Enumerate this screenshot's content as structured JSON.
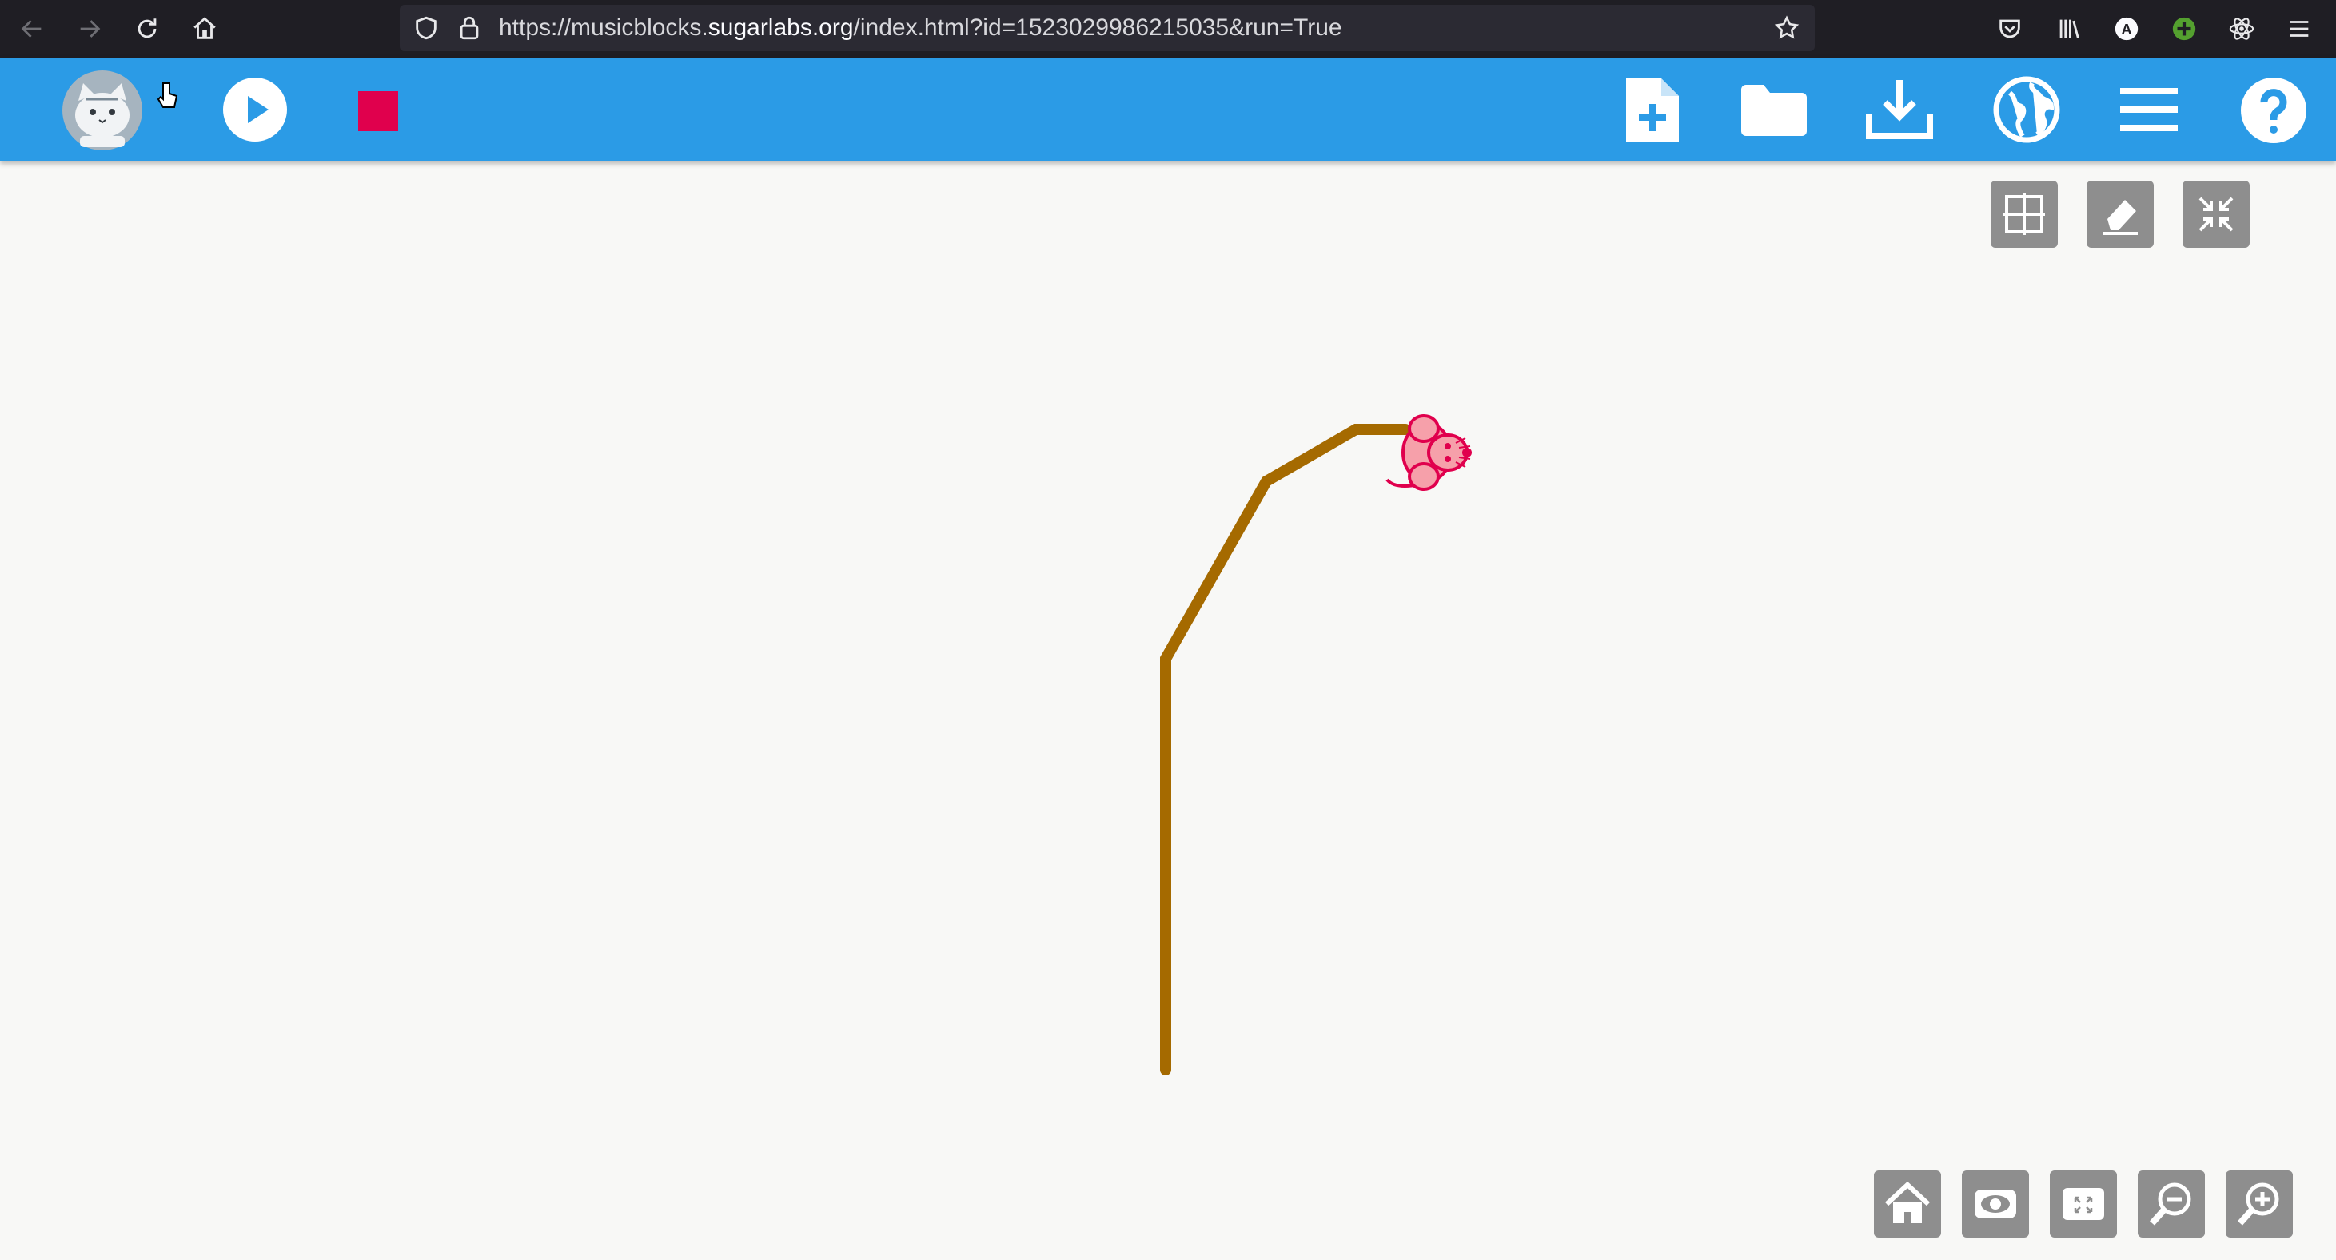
{
  "browser": {
    "url_prefix": "https://musicblocks.",
    "url_domain": "sugarlabs.org",
    "url_suffix": "/index.html?id=1523029986215035&run=True",
    "profile_letter": "A",
    "icons": [
      "back-arrow-icon",
      "forward-arrow-icon",
      "reload-icon",
      "home-icon",
      "shield-icon",
      "lock-icon",
      "star-icon",
      "pocket-icon",
      "library-icon",
      "account-icon",
      "extension-plus-icon",
      "react-devtools-icon",
      "hamburger-menu-icon"
    ]
  },
  "toolbar": {
    "left_buttons": [
      "logo-icon",
      "play-icon",
      "stop-icon"
    ],
    "right_buttons": [
      "new-project-icon",
      "open-folder-icon",
      "save-download-icon",
      "language-globe-icon",
      "menu-icon",
      "help-icon"
    ],
    "stop_color": "#e0004d",
    "bg_color": "#2b9be6"
  },
  "canvas": {
    "top_right_buttons": [
      "grid-icon",
      "eraser-icon",
      "collapse-icon"
    ],
    "bottom_right_buttons": [
      "home-canvas-icon",
      "show-hide-blocks-icon",
      "expand-icon",
      "zoom-out-icon",
      "zoom-in-icon"
    ],
    "pen_color": "#a56a00",
    "turtle_color": "#f6a0aa",
    "turtle_outline": "#e0004d"
  }
}
